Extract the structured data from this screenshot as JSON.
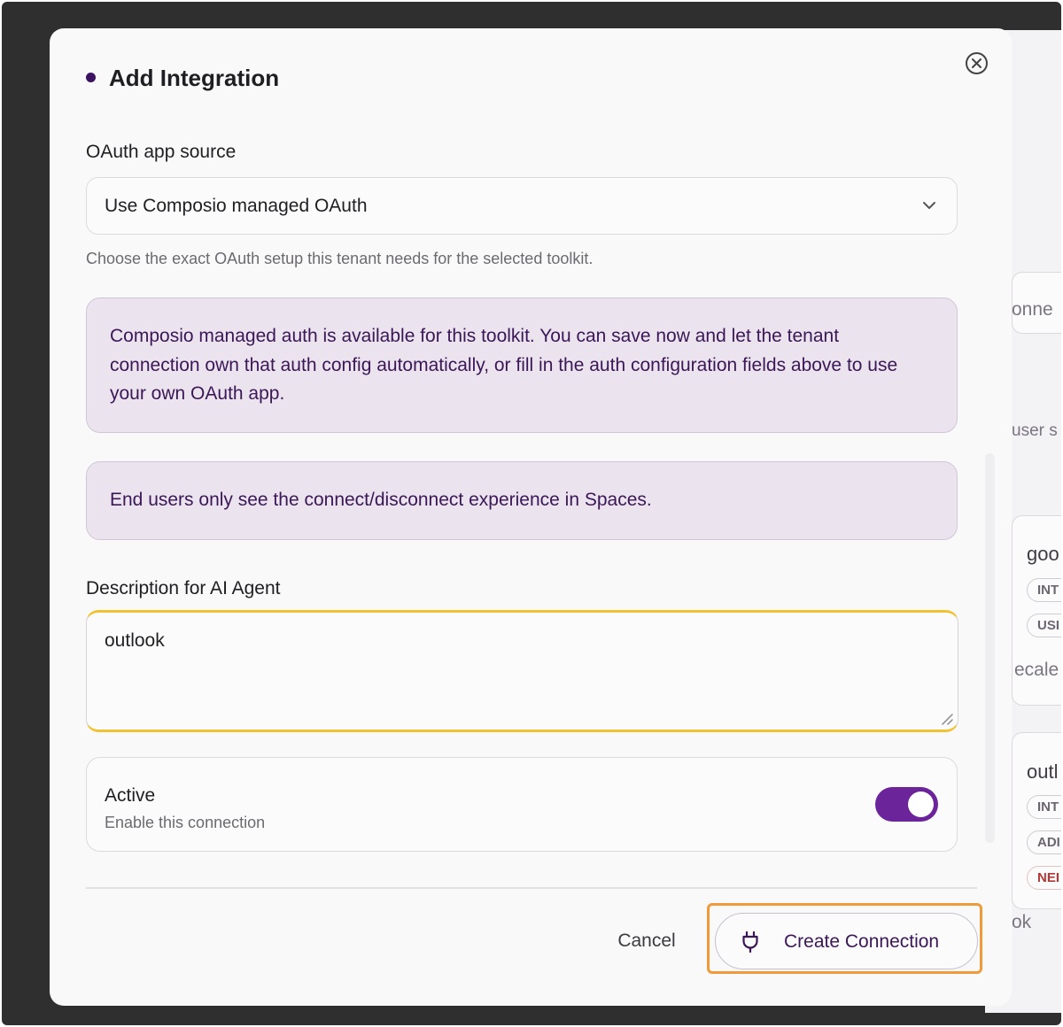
{
  "background_page": {
    "fragments": [
      "onne",
      "user s",
      "goo",
      "INT",
      "USI",
      "ecale",
      "outl",
      "INT",
      "ADI",
      "NEI",
      "ok"
    ]
  },
  "modal": {
    "title": "Add Integration",
    "oauth": {
      "label": "OAuth app source",
      "selected": "Use Composio managed OAuth",
      "helper": "Choose the exact OAuth setup this tenant needs for the selected toolkit."
    },
    "notices": [
      "Composio managed auth is available for this toolkit. You can save now and let the tenant connection own that auth config automatically, or fill in the auth configuration fields above to use your own OAuth app.",
      "End users only see the connect/disconnect experience in Spaces."
    ],
    "description": {
      "label": "Description for AI Agent",
      "value": "outlook"
    },
    "active": {
      "title": "Active",
      "subtitle": "Enable this connection",
      "enabled": true
    },
    "footer": {
      "cancel_label": "Cancel",
      "create_label": "Create Connection"
    }
  },
  "colors": {
    "accent": "#6b2499",
    "notice_bg": "#ebe4ee",
    "focus": "#f1c232",
    "focus_ring": "#ef9a3b"
  },
  "icons": [
    "close-icon",
    "chevron-down-icon",
    "resize-grip-icon",
    "plug-icon"
  ]
}
